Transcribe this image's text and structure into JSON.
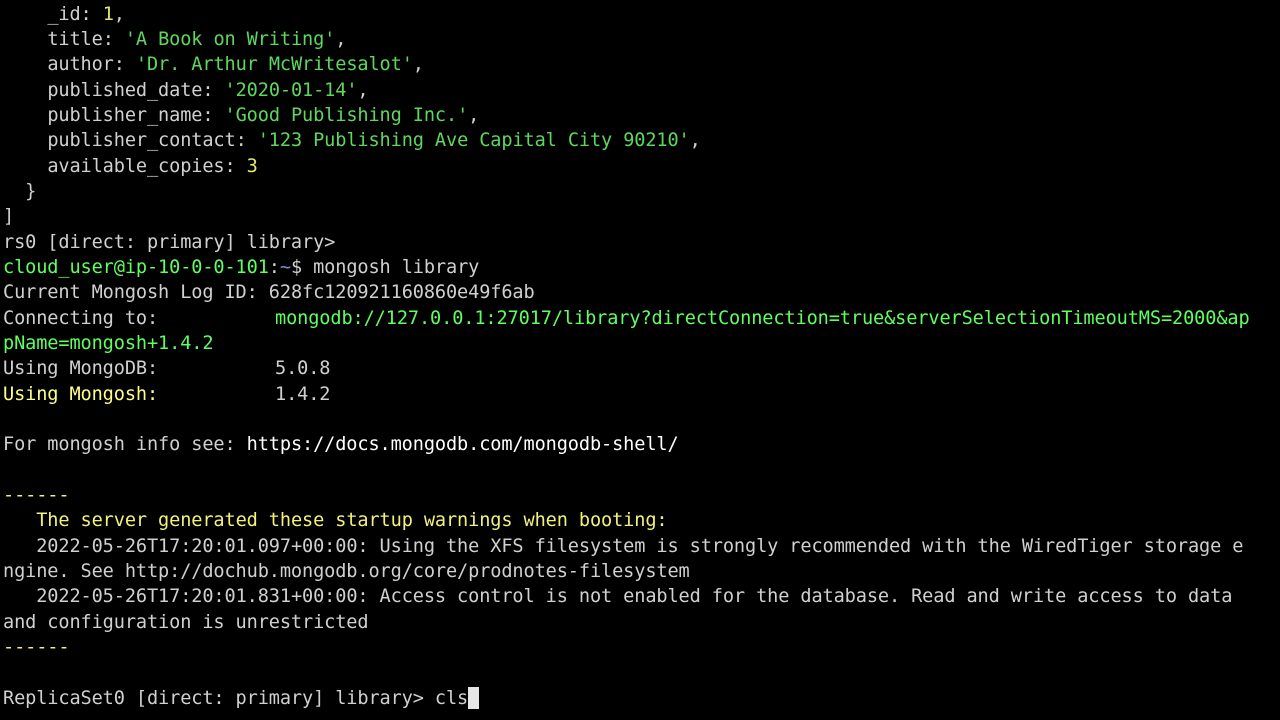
{
  "doc": {
    "id_key": "_id",
    "id_val": "1",
    "title_key": "title",
    "title_val": "'A Book on Writing'",
    "author_key": "author",
    "author_val": "'Dr. Arthur McWritesalot'",
    "published_date_key": "published_date",
    "published_date_val": "'2020-01-14'",
    "publisher_name_key": "publisher_name",
    "publisher_name_val": "'Good Publishing Inc.'",
    "publisher_contact_key": "publisher_contact",
    "publisher_contact_val": "'123 Publishing Ave Capital City 90210'",
    "available_copies_key": "available_copies",
    "available_copies_val": "3",
    "close_brace": "}",
    "close_bracket": "]"
  },
  "prev_prompt": "rs0 [direct: primary] library>",
  "shell": {
    "user_host": "cloud_user@ip-10-0-0-101",
    "sep": ":",
    "path": "~",
    "dollar": "$",
    "command": "mongosh library"
  },
  "info": {
    "log_label": "Current Mongosh Log ID:",
    "log_value": "628fc120921160860e49f6ab",
    "connecting_label": "Connecting to:",
    "connecting_value_1": "mongodb://127.0.0.1:27017/library?directConnection=true&serverSelectionTimeoutMS=2000&ap",
    "connecting_value_2": "pName=mongosh+1.4.2",
    "mongodb_label": "Using MongoDB:",
    "mongodb_value": "5.0.8",
    "mongosh_label": "Using Mongosh:",
    "mongosh_value": "1.4.2",
    "info_label": "For mongosh info see:",
    "info_url": "https://docs.mongodb.com/mongodb-shell/"
  },
  "warnings": {
    "divider": "------",
    "heading": "The server generated these startup warnings when booting:",
    "w1_line1": "2022-05-26T17:20:01.097+00:00: Using the XFS filesystem is strongly recommended with the WiredTiger storage e",
    "w1_line2": "ngine. See http://dochub.mongodb.org/core/prodnotes-filesystem",
    "w2_line1": "2022-05-26T17:20:01.831+00:00: Access control is not enabled for the database. Read and write access to data",
    "w2_line2": "and configuration is unrestricted"
  },
  "prompt": {
    "text": "ReplicaSet0 [direct: primary] library>",
    "input": "cls"
  },
  "colors": {
    "background": "#000000",
    "text": "#d0d0d0",
    "string": "#5fd75f",
    "number": "#e5e570",
    "highlight": "#f2f27a"
  }
}
